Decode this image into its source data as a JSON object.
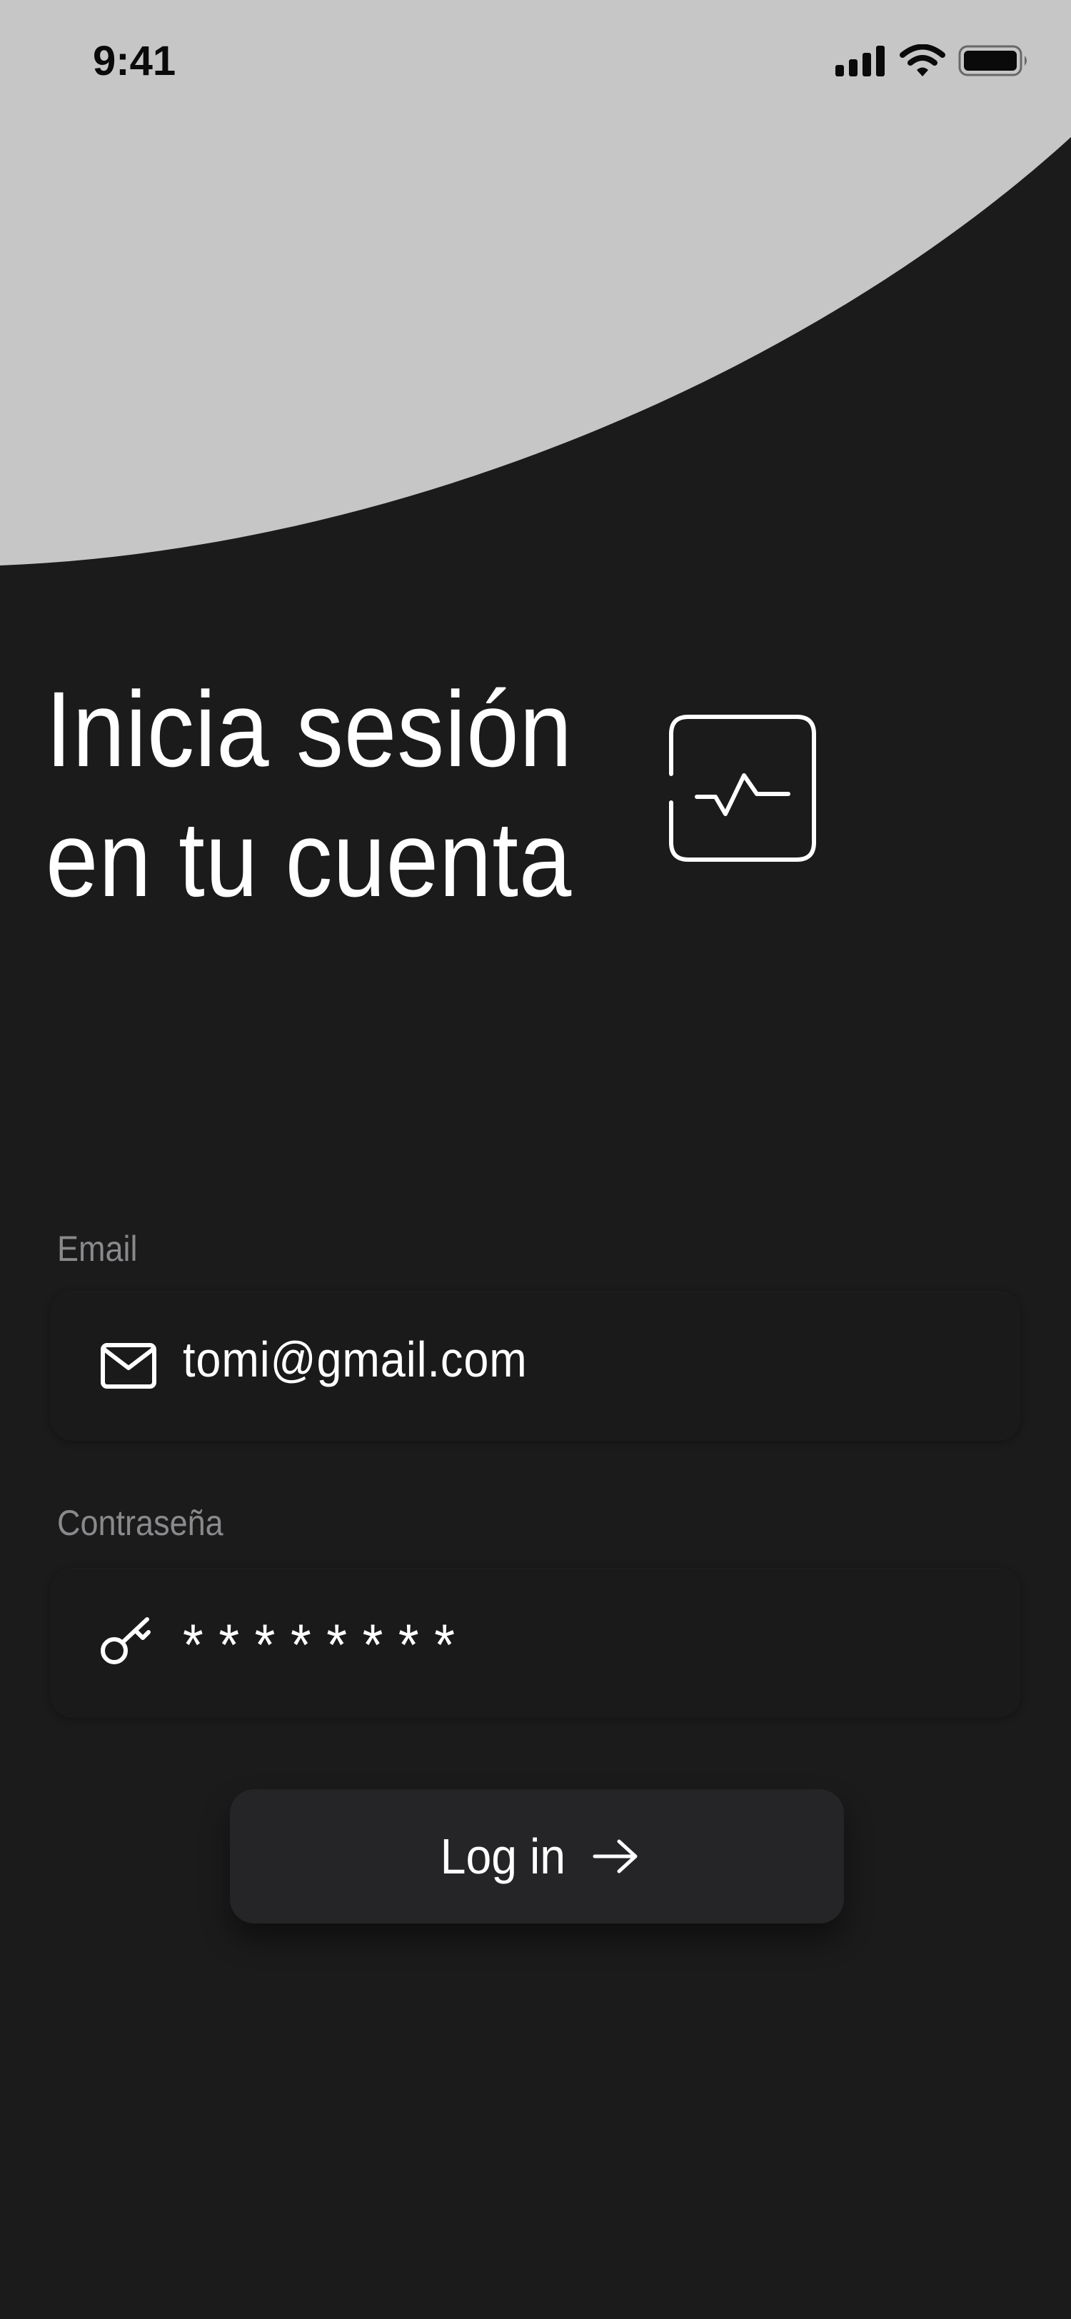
{
  "status_bar": {
    "time": "9:41"
  },
  "header": {
    "title_line1": "Inicia sesión",
    "title_line2": "en tu cuenta",
    "logo_icon": "pulse-wave-icon"
  },
  "form": {
    "email": {
      "label": "Email",
      "value": "tomi@gmail.com",
      "icon": "mail-icon"
    },
    "password": {
      "label": "Contraseña",
      "value": "********",
      "icon": "key-icon"
    },
    "submit": {
      "label": "Log in",
      "icon": "arrow-right-icon"
    }
  },
  "colors": {
    "background": "#1b1b1c",
    "top_curve": "#c6c6c6",
    "input_background": "#1a1a1b",
    "button_background": "#252527",
    "label_text": "#8a8a8d",
    "primary_text": "#ffffff"
  }
}
